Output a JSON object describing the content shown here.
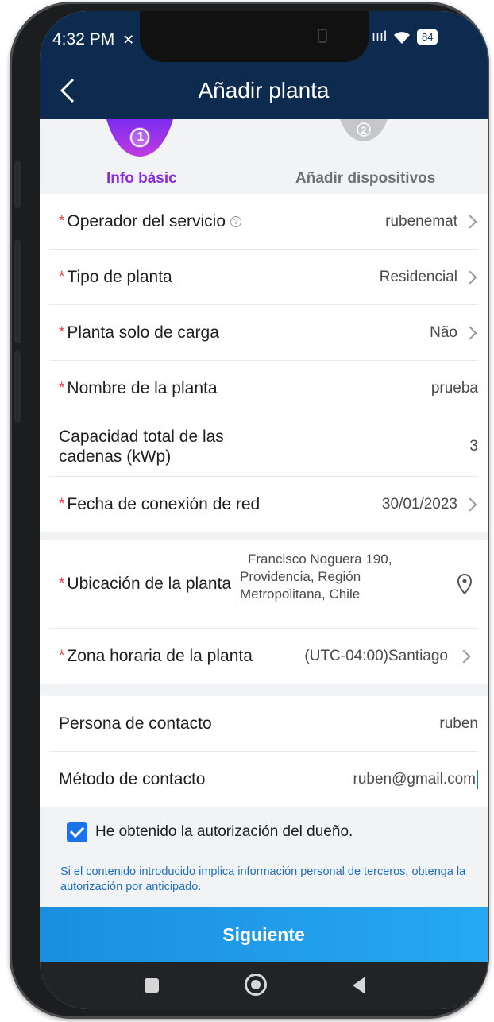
{
  "status_bar": {
    "time": "4:32 PM",
    "signal": "ıııl",
    "battery": "84"
  },
  "header": {
    "title": "Añadir planta"
  },
  "steps": [
    {
      "number": "1",
      "label": "Info básic",
      "active": true
    },
    {
      "number": "2",
      "label": "Añadir dispositivos",
      "active": false
    }
  ],
  "form": {
    "operator": {
      "label": "Operador del servicio",
      "value": "rubenemat"
    },
    "plant_type": {
      "label": "Tipo de planta",
      "value": "Residencial"
    },
    "charge_only": {
      "label": "Planta solo de carga",
      "value": "Não"
    },
    "plant_name": {
      "label": "Nombre de la planta",
      "value": "prueba"
    },
    "capacity": {
      "label_line1": "Capacidad total de las",
      "label_line2": "cadenas (kWp)",
      "value": "3"
    },
    "grid_date": {
      "label": "Fecha de conexión de red",
      "value": "30/01/2023"
    },
    "location": {
      "label": "Ubicación de la planta",
      "address_line1": "Francisco Noguera 190,",
      "address_line2": "Providencia, Región",
      "address_line3": "Metropolitana, Chile"
    },
    "timezone": {
      "label": "Zona horaria de la planta",
      "value": "(UTC-04:00)Santiago"
    },
    "contact_person": {
      "label": "Persona de contacto",
      "value": "ruben"
    },
    "contact_method": {
      "label": "Método de contacto",
      "value": "ruben@gmail.com"
    }
  },
  "consent": {
    "checked": true,
    "label": "He obtenido la autorización del dueño.",
    "notice": "Si el contenido introducido implica información personal de terceros, obtenga la autorización por anticipado."
  },
  "next_button": {
    "label": "Siguiente"
  },
  "colors": {
    "header_bg": "#0c2b4f",
    "active_step": "#8a2be2",
    "required": "#e64545",
    "link_blue": "#1f6fc0",
    "button_blue": "#1a8fe0"
  }
}
